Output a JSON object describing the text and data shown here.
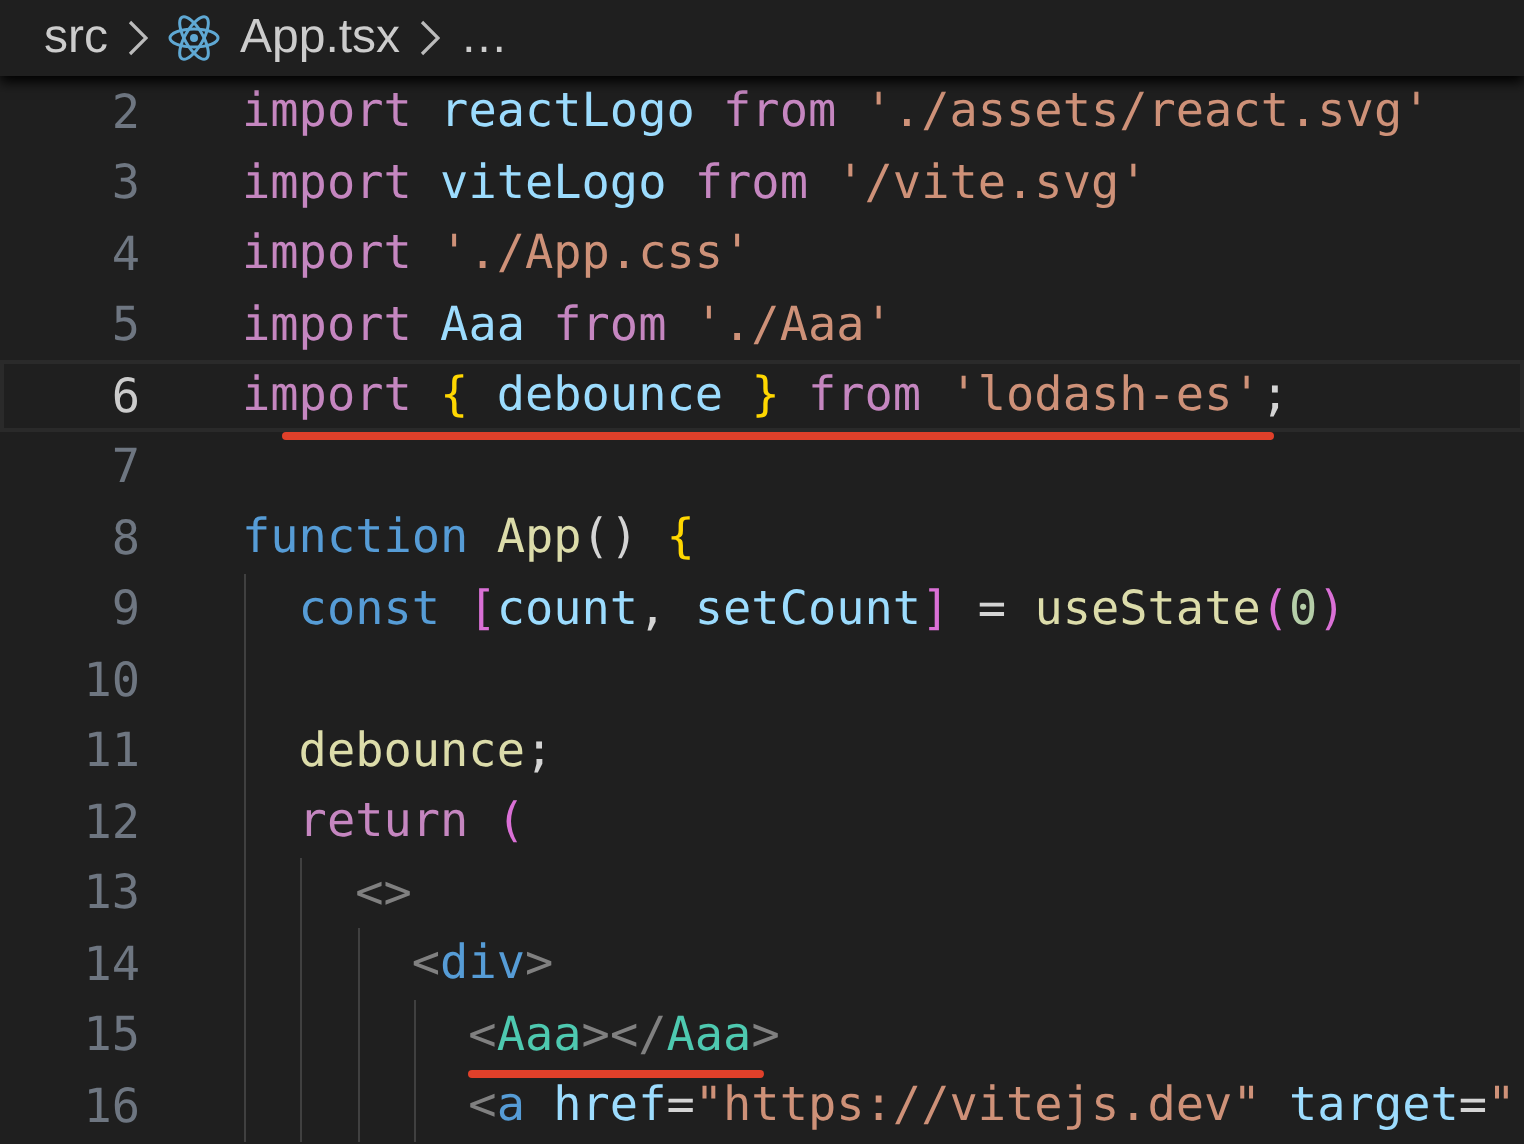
{
  "breadcrumb": [
    {
      "label": "src",
      "kind": "folder"
    },
    {
      "label": "App.tsx",
      "kind": "react-file"
    },
    {
      "label": "…",
      "kind": "more"
    }
  ],
  "lines": [
    {
      "number": "2",
      "current": false,
      "underlined": false,
      "tokens": [
        {
          "text": "import ",
          "kind": "keyword"
        },
        {
          "text": "reactLogo ",
          "kind": "variable"
        },
        {
          "text": "from ",
          "kind": "keyword"
        },
        {
          "text": "'./assets/react.svg'",
          "kind": "string"
        }
      ]
    },
    {
      "number": "3",
      "current": false,
      "underlined": false,
      "tokens": [
        {
          "text": "import ",
          "kind": "keyword"
        },
        {
          "text": "viteLogo ",
          "kind": "variable"
        },
        {
          "text": "from ",
          "kind": "keyword"
        },
        {
          "text": "'/vite.svg'",
          "kind": "string"
        }
      ]
    },
    {
      "number": "4",
      "current": false,
      "underlined": false,
      "tokens": [
        {
          "text": "import ",
          "kind": "keyword"
        },
        {
          "text": "'./App.css'",
          "kind": "string"
        }
      ]
    },
    {
      "number": "5",
      "current": false,
      "underlined": false,
      "tokens": [
        {
          "text": "import ",
          "kind": "keyword"
        },
        {
          "text": "Aaa ",
          "kind": "variable"
        },
        {
          "text": "from ",
          "kind": "keyword"
        },
        {
          "text": "'./Aaa'",
          "kind": "string"
        }
      ]
    },
    {
      "number": "6",
      "current": true,
      "underlined": true,
      "tokens": [
        {
          "text": "import ",
          "kind": "keyword"
        },
        {
          "text": "{ ",
          "kind": "brace"
        },
        {
          "text": "debounce ",
          "kind": "variable"
        },
        {
          "text": "} ",
          "kind": "brace"
        },
        {
          "text": "from ",
          "kind": "keyword"
        },
        {
          "text": "'lodash-es'",
          "kind": "string"
        },
        {
          "text": ";",
          "kind": "plain"
        }
      ]
    },
    {
      "number": "7",
      "current": false,
      "underlined": false
    },
    {
      "number": "8",
      "current": false,
      "underlined": false,
      "tokens": [
        {
          "text": "function ",
          "kind": "storage"
        },
        {
          "text": "App",
          "kind": "function"
        },
        {
          "text": "() ",
          "kind": "plain"
        },
        {
          "text": "{",
          "kind": "brace"
        }
      ]
    },
    {
      "number": "9",
      "current": false,
      "underlined": false,
      "tokens": [
        {
          "text": "  const ",
          "kind": "storage"
        },
        {
          "text": "[",
          "kind": "bracket"
        },
        {
          "text": "count",
          "kind": "variable"
        },
        {
          "text": ", ",
          "kind": "plain"
        },
        {
          "text": "setCount",
          "kind": "variable"
        },
        {
          "text": "]",
          "kind": "bracket"
        },
        {
          "text": " = ",
          "kind": "plain"
        },
        {
          "text": "useState",
          "kind": "function"
        },
        {
          "text": "(",
          "kind": "bracket"
        },
        {
          "text": "0",
          "kind": "number"
        },
        {
          "text": ")",
          "kind": "bracket"
        }
      ]
    },
    {
      "number": "10",
      "current": false,
      "underlined": false
    },
    {
      "number": "11",
      "current": false,
      "underlined": false,
      "tokens": [
        {
          "text": "  debounce",
          "kind": "function"
        },
        {
          "text": ";",
          "kind": "plain"
        }
      ]
    },
    {
      "number": "12",
      "current": false,
      "underlined": false,
      "tokens": [
        {
          "text": "  return ",
          "kind": "keyword"
        },
        {
          "text": "(",
          "kind": "bracket"
        }
      ]
    },
    {
      "number": "13",
      "current": false,
      "underlined": false,
      "tokens": [
        {
          "text": "    <>",
          "kind": "punct"
        }
      ]
    },
    {
      "number": "14",
      "current": false,
      "underlined": false,
      "tokens": [
        {
          "text": "      <",
          "kind": "punct"
        },
        {
          "text": "div",
          "kind": "storage"
        },
        {
          "text": ">",
          "kind": "punct"
        }
      ]
    },
    {
      "number": "15",
      "current": false,
      "underlined": true,
      "tokens": [
        {
          "text": "        <",
          "kind": "punct"
        },
        {
          "text": "Aaa",
          "kind": "component"
        },
        {
          "text": "></",
          "kind": "punct"
        },
        {
          "text": "Aaa",
          "kind": "component"
        },
        {
          "text": ">",
          "kind": "punct"
        }
      ]
    },
    {
      "number": "16",
      "current": false,
      "underlined": false,
      "tokens": [
        {
          "text": "        <",
          "kind": "punct"
        },
        {
          "text": "a ",
          "kind": "storage"
        },
        {
          "text": "href",
          "kind": "variable"
        },
        {
          "text": "=",
          "kind": "plain"
        },
        {
          "text": "\"https://vitejs.dev\" ",
          "kind": "string"
        },
        {
          "text": "target",
          "kind": "variable"
        },
        {
          "text": "=",
          "kind": "plain"
        },
        {
          "text": "\"",
          "kind": "string"
        }
      ]
    }
  ]
}
